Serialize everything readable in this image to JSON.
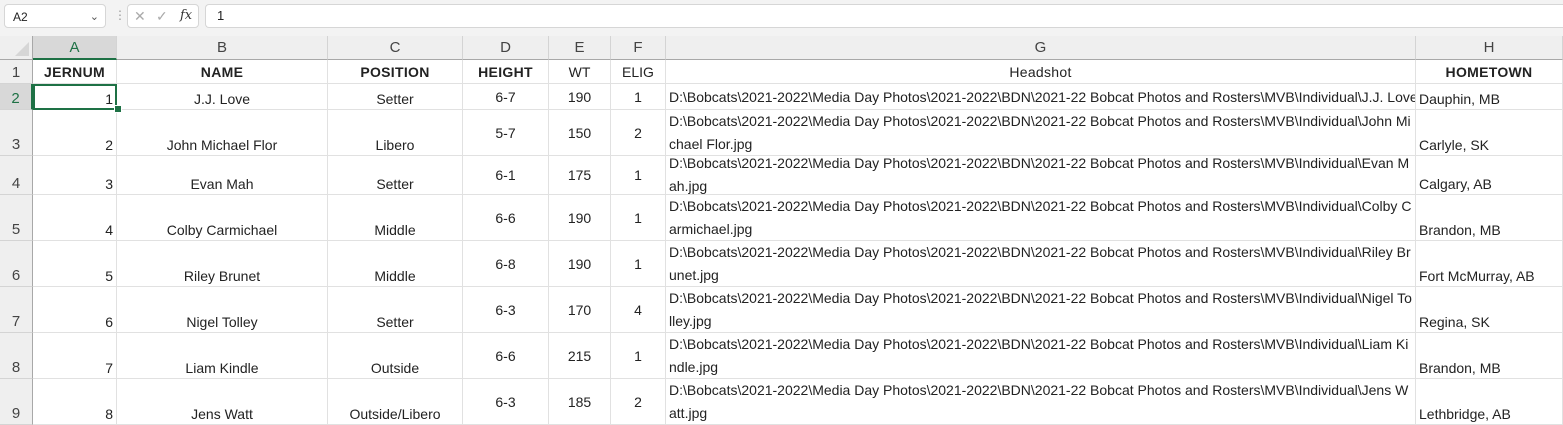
{
  "formula_bar": {
    "name_box": "A2",
    "formula": "1",
    "cancel_icon": "x-icon",
    "enter_icon": "check-icon",
    "fx_label": "fx"
  },
  "columns": [
    "A",
    "B",
    "C",
    "D",
    "E",
    "F",
    "G",
    "H"
  ],
  "selected_cell": "A2",
  "header_row": {
    "row": "1",
    "cells": [
      "JERNUM",
      "NAME",
      "POSITION",
      "HEIGHT",
      "WT",
      "ELIG",
      "Headshot",
      "HOMETOWN"
    ]
  },
  "rows": [
    {
      "row": "2",
      "cells": [
        "1",
        "J.J. Love",
        "Setter",
        "6-7",
        "190",
        "1",
        "D:\\Bobcats\\2021-2022\\Media Day Photos\\2021-2022\\BDN\\2021-22 Bobcat Photos and Rosters\\MVB\\Individual\\J.J. Love.jpg",
        "Dauphin, MB"
      ]
    },
    {
      "row": "3",
      "cells": [
        "2",
        "John Michael Flor",
        "Libero",
        "5-7",
        "150",
        "2",
        "D:\\Bobcats\\2021-2022\\Media Day Photos\\2021-2022\\BDN\\2021-22 Bobcat Photos and Rosters\\MVB\\Individual\\John Michael Flor.jpg",
        "Carlyle, SK"
      ]
    },
    {
      "row": "4",
      "cells": [
        "3",
        "Evan Mah",
        "Setter",
        "6-1",
        "175",
        "1",
        "D:\\Bobcats\\2021-2022\\Media Day Photos\\2021-2022\\BDN\\2021-22 Bobcat Photos and Rosters\\MVB\\Individual\\Evan Mah.jpg",
        "Calgary, AB"
      ]
    },
    {
      "row": "5",
      "cells": [
        "4",
        "Colby Carmichael",
        "Middle",
        "6-6",
        "190",
        "1",
        "D:\\Bobcats\\2021-2022\\Media Day Photos\\2021-2022\\BDN\\2021-22 Bobcat Photos and Rosters\\MVB\\Individual\\Colby Carmichael.jpg",
        "Brandon, MB"
      ]
    },
    {
      "row": "6",
      "cells": [
        "5",
        "Riley Brunet",
        "Middle",
        "6-8",
        "190",
        "1",
        "D:\\Bobcats\\2021-2022\\Media Day Photos\\2021-2022\\BDN\\2021-22 Bobcat Photos and Rosters\\MVB\\Individual\\Riley Brunet.jpg",
        "Fort McMurray, AB"
      ]
    },
    {
      "row": "7",
      "cells": [
        "6",
        "Nigel Tolley",
        "Setter",
        "6-3",
        "170",
        "4",
        "D:\\Bobcats\\2021-2022\\Media Day Photos\\2021-2022\\BDN\\2021-22 Bobcat Photos and Rosters\\MVB\\Individual\\Nigel Tolley.jpg",
        "Regina, SK"
      ]
    },
    {
      "row": "8",
      "cells": [
        "7",
        "Liam Kindle",
        "Outside",
        "6-6",
        "215",
        "1",
        "D:\\Bobcats\\2021-2022\\Media Day Photos\\2021-2022\\BDN\\2021-22 Bobcat Photos and Rosters\\MVB\\Individual\\Liam Kindle.jpg",
        "Brandon, MB"
      ]
    },
    {
      "row": "9",
      "cells": [
        "8",
        "Jens Watt",
        "Outside/Libero",
        "6-3",
        "185",
        "2",
        "D:\\Bobcats\\2021-2022\\Media Day Photos\\2021-2022\\BDN\\2021-22 Bobcat Photos and Rosters\\MVB\\Individual\\Jens Watt.jpg",
        "Lethbridge, AB"
      ]
    }
  ]
}
